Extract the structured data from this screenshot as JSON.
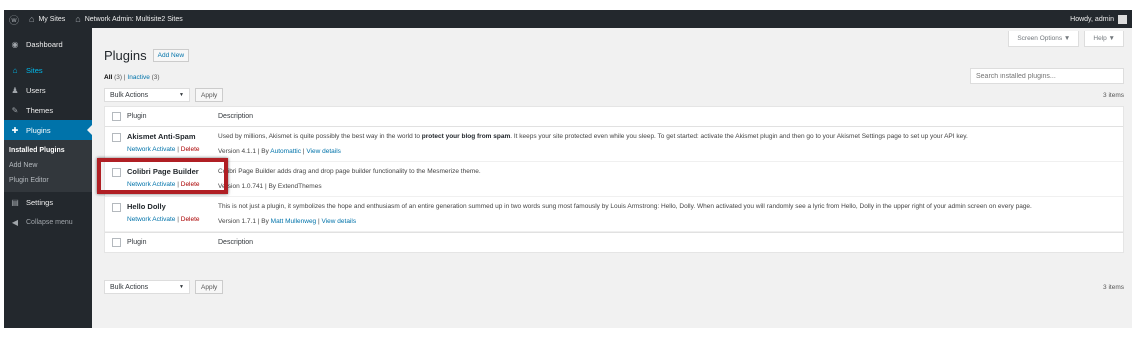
{
  "adminbar": {
    "wp_logo": "wordpress-icon",
    "my_sites": "My Sites",
    "network_admin": "Network Admin: Multisite2 Sites",
    "howdy": "Howdy, admin"
  },
  "sidebar": {
    "items": [
      {
        "label": "Dashboard",
        "icon": "dashboard-icon"
      },
      {
        "label": "Sites",
        "icon": "sites-icon"
      },
      {
        "label": "Users",
        "icon": "users-icon"
      },
      {
        "label": "Themes",
        "icon": "themes-icon"
      },
      {
        "label": "Plugins",
        "icon": "plugins-icon"
      },
      {
        "label": "Settings",
        "icon": "settings-icon"
      },
      {
        "label": "Collapse menu",
        "icon": "collapse-icon"
      }
    ],
    "submenu": [
      "Installed Plugins",
      "Add New",
      "Plugin Editor"
    ]
  },
  "screen_options": "Screen Options",
  "help": "Help",
  "page": {
    "title": "Plugins",
    "add_new": "Add New"
  },
  "filters": {
    "all": "All",
    "all_count": "(3)",
    "sep": "|",
    "inactive": "Inactive",
    "inactive_count": "(3)"
  },
  "search": {
    "placeholder": "Search installed plugins..."
  },
  "bulk": {
    "label": "Bulk Actions",
    "apply": "Apply",
    "count": "3 items"
  },
  "table": {
    "col_plugin": "Plugin",
    "col_description": "Description",
    "rows": [
      {
        "name": "Akismet Anti-Spam",
        "activate": "Network Activate",
        "sep": "|",
        "delete": "Delete",
        "desc_before": "Used by millions, Akismet is quite possibly the best way in the world to ",
        "desc_bold": "protect your blog from spam",
        "desc_after": ". It keeps your site protected even while you sleep. To get started: activate the Akismet plugin and then go to your Akismet Settings page to set up your API key.",
        "version": "Version 4.1.1 | By",
        "author": "Automattic",
        "details": "View details"
      },
      {
        "name": "Colibri Page Builder",
        "activate": "Network Activate",
        "sep": "|",
        "delete": "Delete",
        "desc": "Colibri Page Builder adds drag and drop page builder functionality to the Mesmerize theme.",
        "version": "Version 1.0.741 | By ExtendThemes"
      },
      {
        "name": "Hello Dolly",
        "activate": "Network Activate",
        "sep": "|",
        "delete": "Delete",
        "desc": "This is not just a plugin, it symbolizes the hope and enthusiasm of an entire generation summed up in two words sung most famously by Louis Armstrong: Hello, Dolly. When activated you will randomly see a lyric from Hello, Dolly in the upper right of your admin screen on every page.",
        "version": "Version 1.7.1 | By",
        "author": "Matt Mullenweg",
        "details": "View details"
      }
    ]
  },
  "colors": {
    "adminbar": "#23282d",
    "accent": "#0073aa",
    "delete": "#a00",
    "highlight": "#b01f24"
  }
}
